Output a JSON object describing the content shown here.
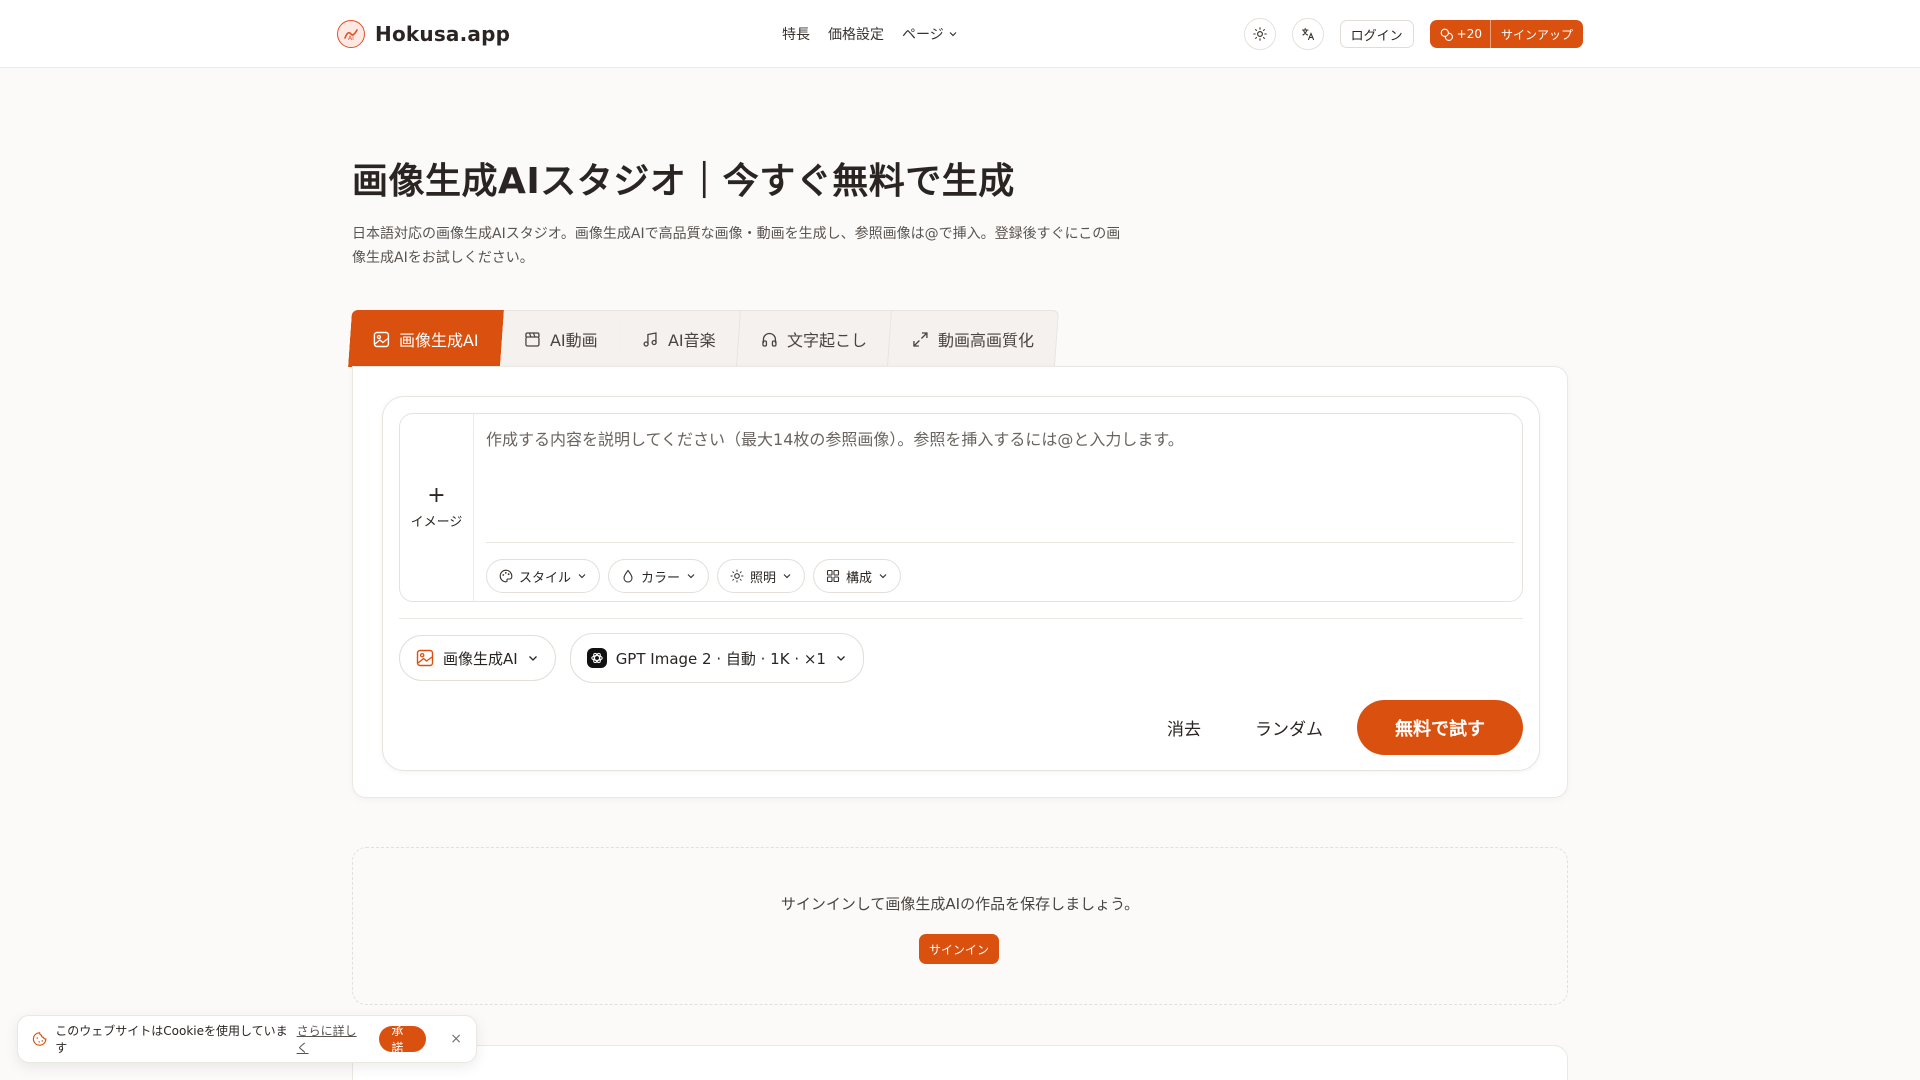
{
  "header": {
    "brand_name": "Hokusa.app",
    "nav": {
      "features": "特長",
      "pricing": "価格設定",
      "pages": "ページ"
    },
    "login": "ログイン",
    "signup_credits": "+20",
    "signup": "サインアップ"
  },
  "hero": {
    "title": "画像生成AIスタジオ｜今すぐ無料で生成",
    "description": "日本語対応の画像生成AIスタジオ。画像生成AIで高品質な画像・動画を生成し、参照画像は@で挿入。登録後すぐにこの画像生成AIをお試しください。"
  },
  "tabs": [
    {
      "label": "画像生成AI",
      "icon": "image-icon"
    },
    {
      "label": "AI動画",
      "icon": "clapperboard-icon"
    },
    {
      "label": "AI音楽",
      "icon": "music-note-icon"
    },
    {
      "label": "文字起こし",
      "icon": "headphones-icon"
    },
    {
      "label": "動画高画質化",
      "icon": "expand-icon"
    }
  ],
  "composer": {
    "add_image": "イメージ",
    "prompt_placeholder": "作成する内容を説明してください（最大14枚の参照画像）。参照を挿入するには@と入力します。",
    "options": {
      "style": "スタイル",
      "color": "カラー",
      "lighting": "照明",
      "composition": "構成"
    },
    "mode": "画像生成AI",
    "model": "GPT Image 2 · 自動 · 1K · ×1",
    "clear": "消去",
    "random": "ランダム",
    "try": "無料で試す"
  },
  "save_prompt": {
    "text": "サインインして画像生成AIの作品を保存しましょう。",
    "button": "サインイン"
  },
  "cookie": {
    "text": "このウェブサイトはCookieを使用しています",
    "link": "さらに詳しく",
    "accept": "承諾",
    "close": "×"
  },
  "colors": {
    "accent": "#d9500f",
    "background": "#fbfaf9"
  }
}
